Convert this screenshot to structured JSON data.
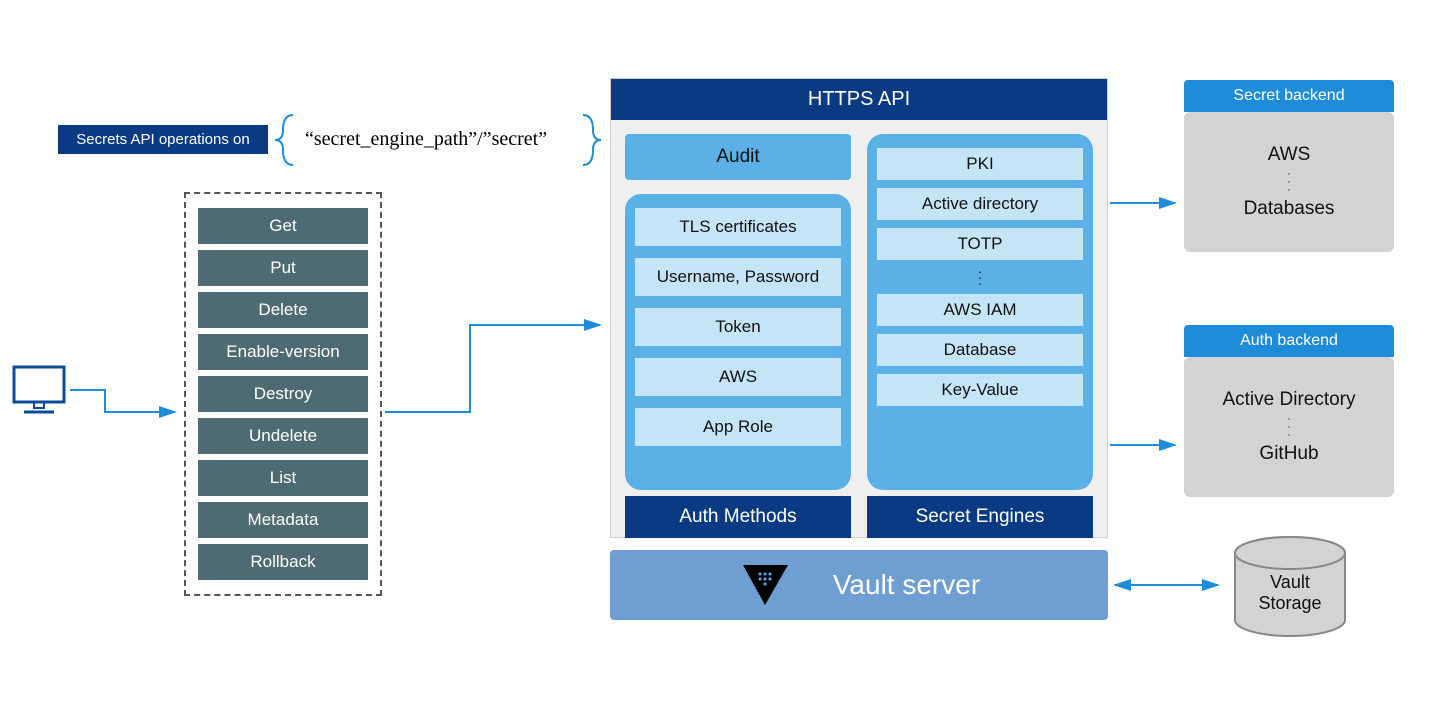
{
  "labels": {
    "secrets_api_ops": "Secrets API operations on",
    "path": "“secret_engine_path”/”secret”",
    "https_api": "HTTPS API",
    "audit": "Audit",
    "auth_methods": "Auth Methods",
    "secret_engines": "Secret Engines",
    "vault_server": "Vault server",
    "secret_backend": "Secret backend",
    "auth_backend": "Auth backend",
    "vault_storage_1": "Vault",
    "vault_storage_2": "Storage"
  },
  "operations": [
    "Get",
    "Put",
    "Delete",
    "Enable-version",
    "Destroy",
    "Undelete",
    "List",
    "Metadata",
    "Rollback"
  ],
  "auth_items": [
    "TLS certificates",
    "Username, Password",
    "Token",
    "AWS",
    "App Role"
  ],
  "secret_items": [
    "PKI",
    "Active directory",
    "TOTP",
    "AWS IAM",
    "Database",
    "Key-Value"
  ],
  "secret_backend": {
    "line1": "AWS",
    "line2": "Databases"
  },
  "auth_backend": {
    "line1": "Active Directory",
    "line2": "GitHub"
  }
}
